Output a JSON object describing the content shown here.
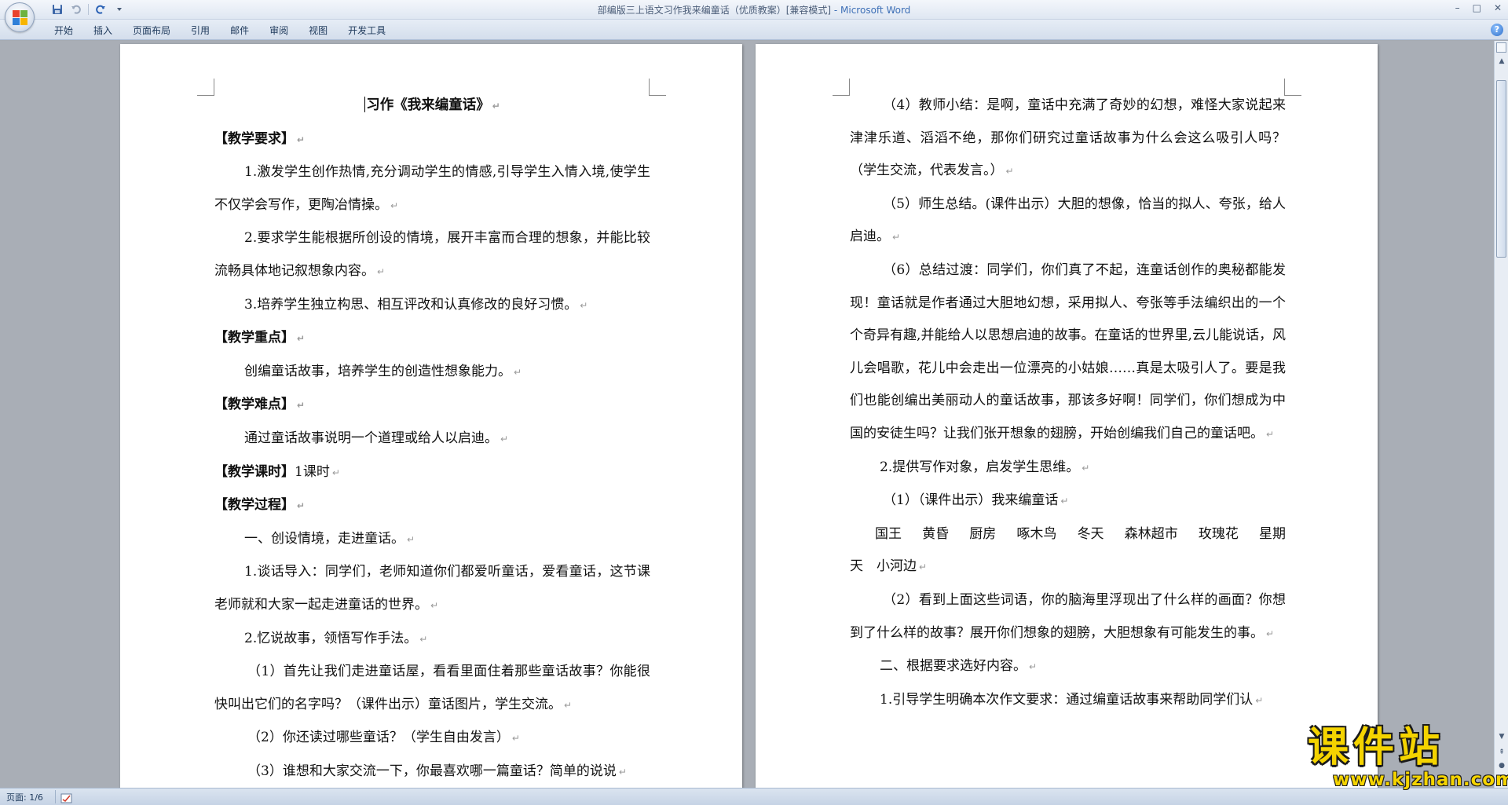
{
  "window": {
    "title": "部编版三上语文习作我来编童话（优质教案）[兼容模式]",
    "app_name": " - Microsoft Word",
    "controls": [
      "–",
      "□",
      "✕"
    ]
  },
  "ribbon": {
    "tabs": [
      "开始",
      "插入",
      "页面布局",
      "引用",
      "邮件",
      "审阅",
      "视图",
      "开发工具"
    ],
    "help": "?"
  },
  "status": {
    "page": "页面: 1/6"
  },
  "watermark": {
    "text": "课件站",
    "url": "www.kjzhan.com"
  },
  "pilcrow": "↵",
  "left_page": {
    "title": "习作《我来编童话》",
    "paragraphs": [
      {
        "style": "heading",
        "text": "【教学要求】"
      },
      {
        "style": "indent",
        "text": "1.激发学生创作热情,充分调动学生的情感,引导学生入情入境,使学生不仅学会写作，更陶冶情操。"
      },
      {
        "style": "indent",
        "text": "2.要求学生能根据所创设的情境，展开丰富而合理的想象，并能比较流畅具体地记叙想象内容。"
      },
      {
        "style": "indent",
        "text": "3.培养学生独立构思、相互评改和认真修改的良好习惯。"
      },
      {
        "style": "heading",
        "text": "【教学重点】"
      },
      {
        "style": "indent",
        "text": "创编童话故事，培养学生的创造性想象能力。"
      },
      {
        "style": "heading",
        "text": "【教学难点】"
      },
      {
        "style": "indent",
        "text": "通过童话故事说明一个道理或给人以启迪。"
      },
      {
        "style": "mixed",
        "bold": "【教学课时】",
        "text": "1课时"
      },
      {
        "style": "heading",
        "text": "【教学过程】"
      },
      {
        "style": "indent",
        "text": "一、创设情境，走进童话。"
      },
      {
        "style": "indent",
        "text": "1.谈话导入：同学们，老师知道你们都爱听童话，爱看童话，这节课老师就和大家一起走进童话的世界。"
      },
      {
        "style": "indent",
        "text": "2.忆说故事，领悟写作手法。"
      },
      {
        "style": "sub",
        "text": "（1）首先让我们走进童话屋，看看里面住着那些童话故事？你能很快叫出它们的名字吗？（课件出示）童话图片，学生交流。"
      },
      {
        "style": "sub",
        "text": "（2）你还读过哪些童话？（学生自由发言）"
      },
      {
        "style": "sub",
        "text": "（3）谁想和大家交流一下，你最喜欢哪一篇童话？简单的说说"
      }
    ]
  },
  "right_page": {
    "paragraphs": [
      {
        "style": "sub",
        "text": "（4）教师小结：是啊，童话中充满了奇妙的幻想，难怪大家说起来津津乐道、滔滔不绝，那你们研究过童话故事为什么会这么吸引人吗？（学生交流，代表发言。）"
      },
      {
        "style": "sub",
        "text": "（5）师生总结。(课件出示）大胆的想像，恰当的拟人、夸张，给人启迪。"
      },
      {
        "style": "sub",
        "text": "（6）总结过渡：同学们，你们真了不起，连童话创作的奥秘都能发现！童话就是作者通过大胆地幻想，采用拟人、夸张等手法编织出的一个个奇异有趣,并能给人以思想启迪的故事。在童话的世界里,云儿能说话，风儿会唱歌，花儿中会走出一位漂亮的小姑娘……真是太吸引人了。要是我们也能创编出美丽动人的童话故事，那该多好啊！同学们，你们想成为中国的安徒生吗？让我们张开想象的翅膀，开始创编我们自己的童话吧。"
      },
      {
        "style": "indent",
        "text": "2.提供写作对象，启发学生思维。"
      },
      {
        "style": "sub",
        "text": "（1）（课件出示）我来编童话"
      },
      {
        "style": "words",
        "words": [
          "国王",
          "黄昏",
          "厨房",
          "啄木鸟",
          "冬天",
          "森林超市",
          "玫瑰花",
          "星期"
        ]
      },
      {
        "style": "plain",
        "text": "天　小河边"
      },
      {
        "style": "sub",
        "text": "（2）看到上面这些词语，你的脑海里浮现出了什么样的画面？你想到了什么样的故事？展开你们想象的翅膀，大胆想象有可能发生的事。"
      },
      {
        "style": "indent",
        "text": "二、根据要求选好内容。"
      },
      {
        "style": "indent",
        "text": "1.引导学生明确本次作文要求：通过编童话故事来帮助同学们认"
      }
    ]
  }
}
